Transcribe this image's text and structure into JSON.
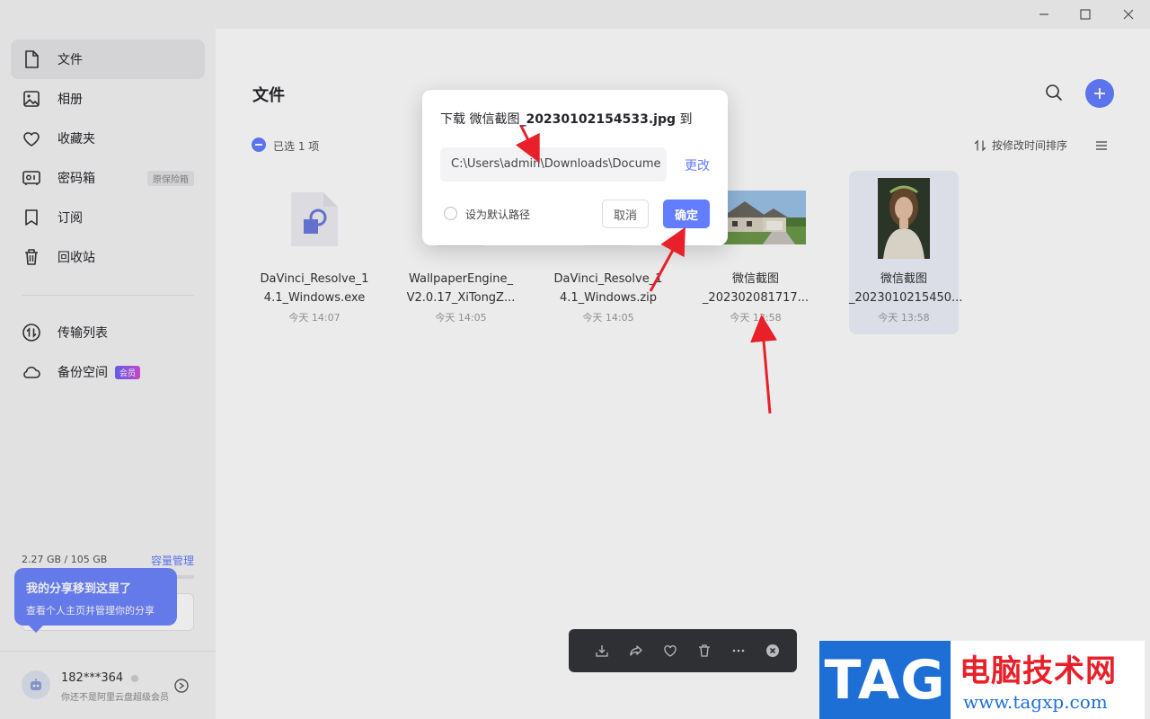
{
  "window": {
    "controls": [
      "minimize",
      "maximize",
      "close"
    ]
  },
  "sidebar": {
    "items": [
      {
        "label": "文件",
        "icon": "file-icon",
        "active": true
      },
      {
        "label": "相册",
        "icon": "photo-icon"
      },
      {
        "label": "收藏夹",
        "icon": "heart-icon"
      },
      {
        "label": "密码箱",
        "icon": "safe-icon",
        "tag": "原保险箱"
      },
      {
        "label": "订阅",
        "icon": "bookmark-icon"
      },
      {
        "label": "回收站",
        "icon": "trash-icon"
      },
      {
        "label": "传输列表",
        "icon": "transfer-icon"
      },
      {
        "label": "备份空间",
        "icon": "cloud-icon",
        "tag": "会员"
      }
    ],
    "storage": {
      "used_text": "2.27 GB / 105 GB",
      "manage_label": "容量管理",
      "used_fraction": 0.022
    },
    "tooltip": {
      "title": "我的分享移到这里了",
      "body": "查看个人主页并管理你的分享"
    },
    "user": {
      "name": "182***364",
      "subtitle": "你还不是阿里云盘超级会员"
    }
  },
  "main": {
    "title": "文件",
    "selection_text": "已选 1 项",
    "sort_label": "按修改时间排序",
    "files": [
      {
        "name_line1": "DaVinci_Resolve_1",
        "name_line2": "4.1_Windows.exe",
        "date": "今天 14:07",
        "type": "exe"
      },
      {
        "name_line1": "WallpaperEngine_",
        "name_line2": "V2.0.17_XiTongZ...",
        "date": "今天 14:05",
        "type": "archive"
      },
      {
        "name_line1": "DaVinci_Resolve_1",
        "name_line2": "4.1_Windows.zip",
        "date": "今天 14:05",
        "type": "archive"
      },
      {
        "name_line1": "微信截图",
        "name_line2": "_202302081717...",
        "date": "今天 13:58",
        "type": "image-house"
      },
      {
        "name_line1": "微信截图",
        "name_line2": "_2023010215450...",
        "date": "今天 13:58",
        "type": "image-portrait",
        "selected": true
      }
    ]
  },
  "dialog": {
    "title_prefix": "下载 微信截图",
    "title_file": "_20230102154533.jpg",
    "title_suffix": "到",
    "path": "C:\\Users\\admin\\Downloads\\Docume",
    "change_label": "更改",
    "default_path_label": "设为默认路径",
    "cancel_label": "取消",
    "ok_label": "确定"
  },
  "actionbar": {
    "actions": [
      "download-icon",
      "share-icon",
      "favorite-icon",
      "delete-icon",
      "more-icon",
      "close-icon"
    ]
  },
  "watermark": {
    "tag": "TAG",
    "site_name": "电脑技术网",
    "url": "www.tagxp.com"
  },
  "colors": {
    "accent": "#637dff",
    "sidebar_bg": "#f5f5f6",
    "annotation_arrow": "#e8202a"
  }
}
